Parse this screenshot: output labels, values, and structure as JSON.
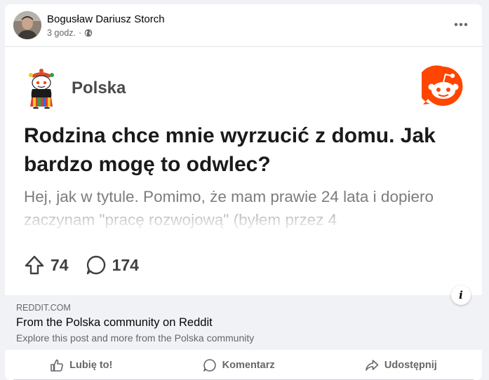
{
  "post": {
    "author": "Bogusław Dariusz Storch",
    "time": "3 godz.",
    "separator": "·",
    "audience_icon": "globe-icon",
    "more_icon": "ellipsis-icon"
  },
  "preview": {
    "subreddit": "Polska",
    "title": "Rodzina chce mnie wyrzucić z domu. Jak bardzo mogę to odwlec?",
    "body": "Hej, jak w tytule. Pomimo, że mam prawie 24 lata i dopiero zaczynam \"pracę rozwojową\" (byłem przez 4",
    "upvotes": "74",
    "comments": "174",
    "brand_color": "#ff4500"
  },
  "link": {
    "domain": "REDDIT.COM",
    "title": "From the Polska community on Reddit",
    "description": "Explore this post and more from the Polska community",
    "info_label": "i"
  },
  "actions": {
    "like": "Lubię to!",
    "comment": "Komentarz",
    "share": "Udostępnij"
  }
}
